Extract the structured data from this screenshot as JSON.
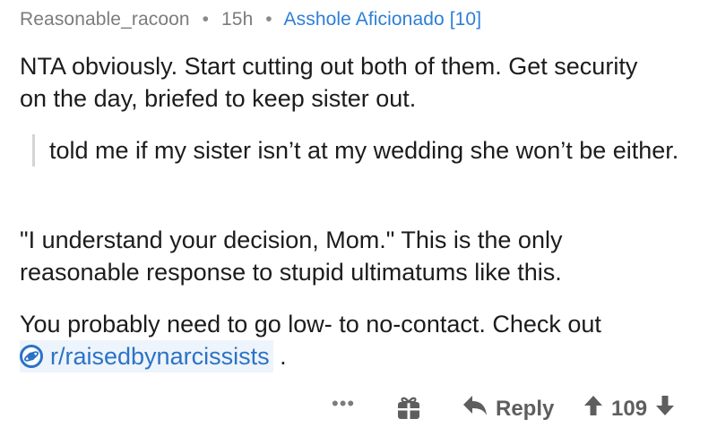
{
  "header": {
    "username": "Reasonable_racoon",
    "time": "15h",
    "flair": "Asshole Aficionado [10]",
    "separator": "•"
  },
  "body": {
    "p1": "NTA obviously. Start cutting out both of them. Get security on the day, briefed to keep sister out.",
    "quote": "told me if my sister isn’t at my wedding she won’t be either.",
    "p2": "\"I understand your decision, Mom.\" This is the only reasonable response to stupid ultimatums like this.",
    "p3_text": "You probably need to go low- to no-contact. Check out",
    "subreddit_link": "r/raisedbynarcissists",
    "p3_end": " ."
  },
  "actions": {
    "more": "•••",
    "reply_label": "Reply",
    "score": "109"
  },
  "icons": {
    "subreddit": "subreddit-planet-icon",
    "award": "gift-award-icon",
    "reply": "reply-arrow-icon",
    "upvote": "upvote-arrow-icon",
    "downvote": "downvote-arrow-icon"
  },
  "colors": {
    "link": "#2b73c6",
    "flair": "#2d7fd6",
    "meta": "#7c7c7c",
    "action": "#5e5e5e"
  }
}
